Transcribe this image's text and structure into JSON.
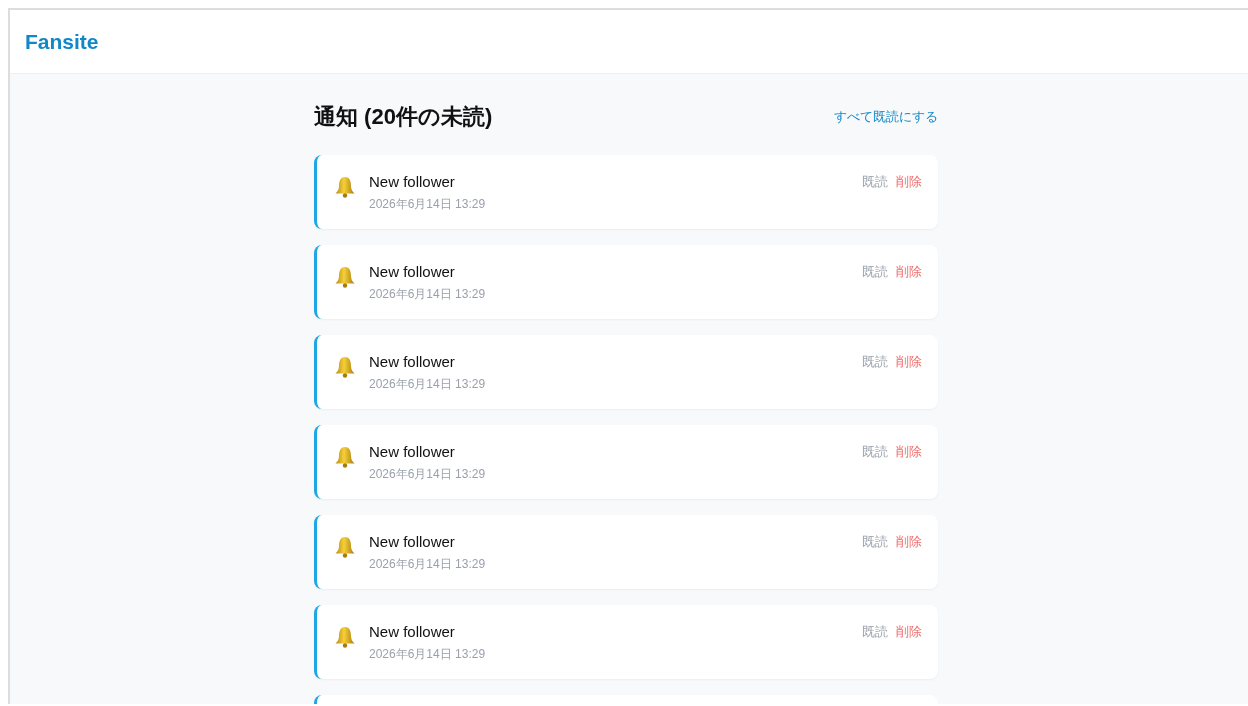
{
  "header": {
    "logo": "Fansite"
  },
  "page": {
    "title": "通知 (20件の未読)",
    "mark_all_read": "すべて既読にする"
  },
  "notifications": [
    {
      "title": "New follower",
      "time": "2026年6月14日 13:29",
      "read_action": "既読",
      "delete_action": "削除",
      "unread": true
    },
    {
      "title": "New follower",
      "time": "2026年6月14日 13:29",
      "read_action": "既読",
      "delete_action": "削除",
      "unread": true
    },
    {
      "title": "New follower",
      "time": "2026年6月14日 13:29",
      "read_action": "既読",
      "delete_action": "削除",
      "unread": true
    },
    {
      "title": "New follower",
      "time": "2026年6月14日 13:29",
      "read_action": "既読",
      "delete_action": "削除",
      "unread": true
    },
    {
      "title": "New follower",
      "time": "2026年6月14日 13:29",
      "read_action": "既読",
      "delete_action": "削除",
      "unread": true
    },
    {
      "title": "New follower",
      "time": "2026年6月14日 13:29",
      "read_action": "既読",
      "delete_action": "削除",
      "unread": true
    },
    {
      "unread": true
    }
  ]
}
